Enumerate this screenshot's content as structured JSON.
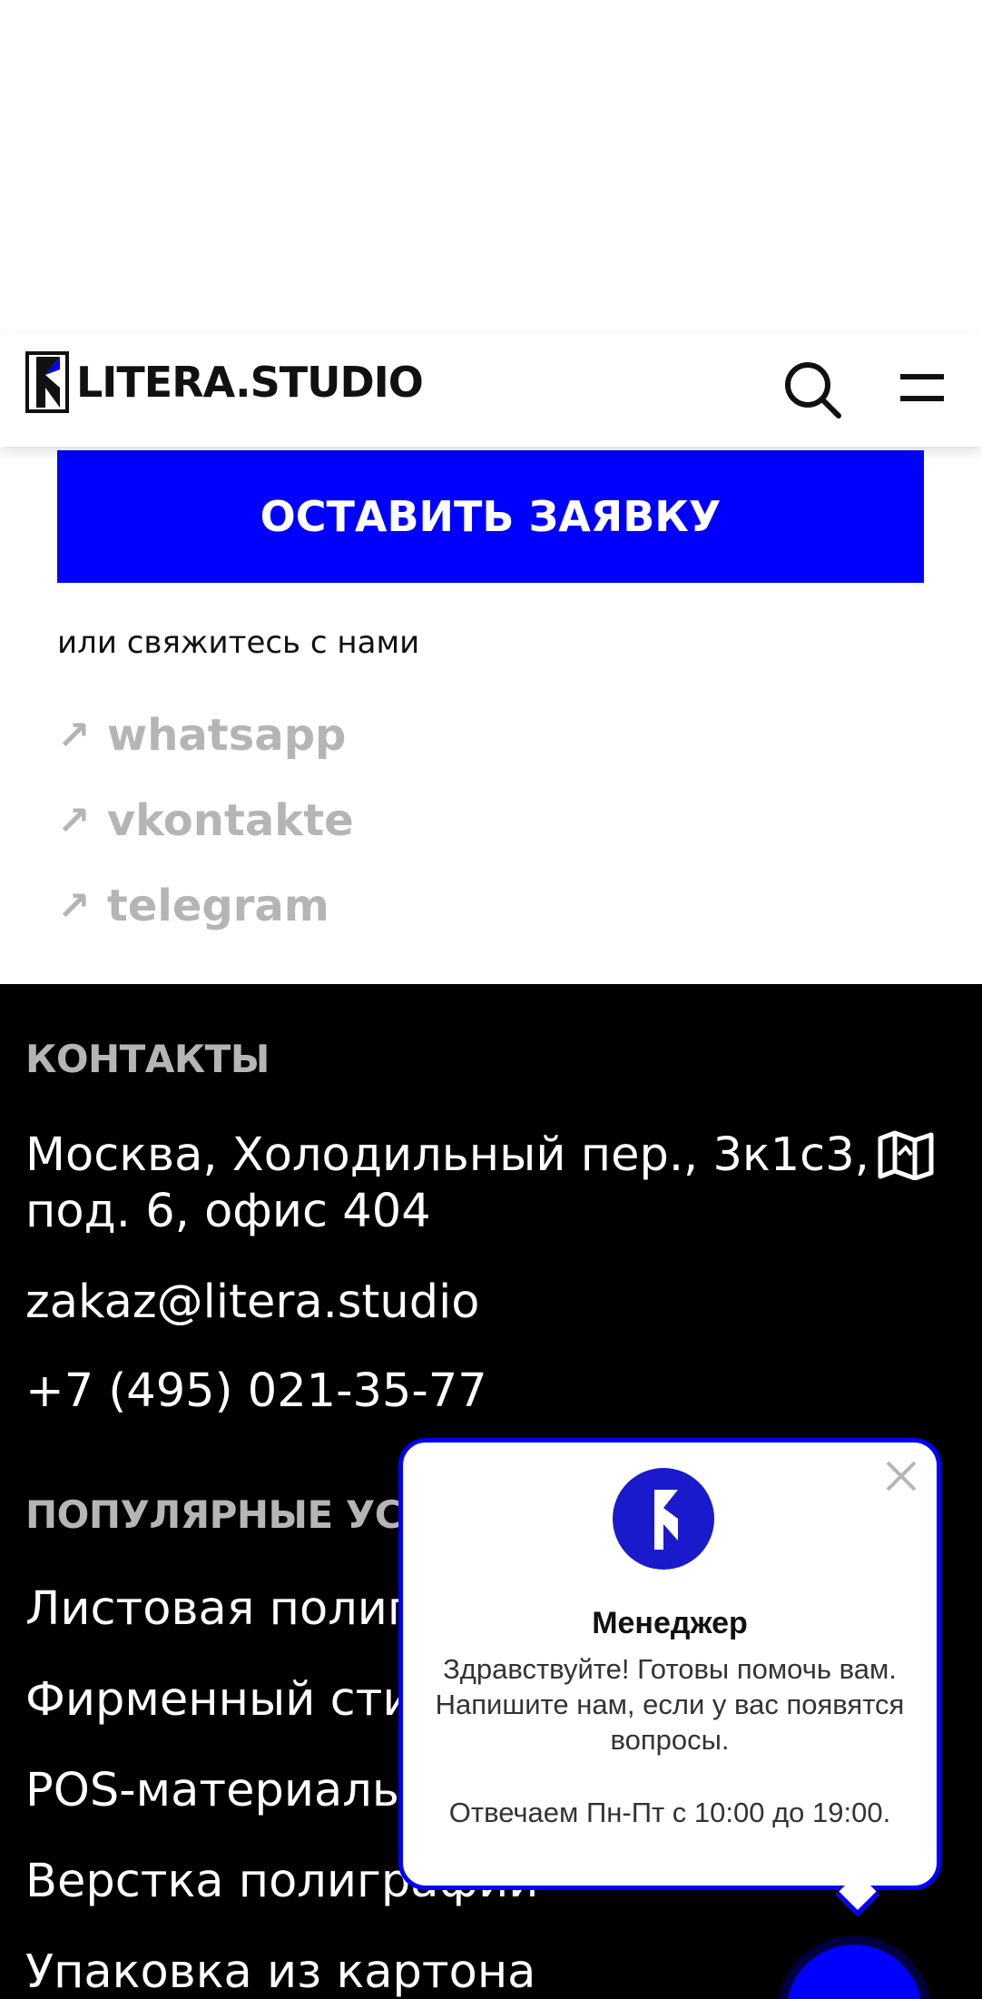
{
  "header": {
    "logo_text": "LITERA.STUDIO",
    "search_icon": "search-icon",
    "menu_icon": "hamburger-icon"
  },
  "cta": {
    "button_label": "ОСТАВИТЬ ЗАЯВКУ",
    "contact_hint": "или свяжитесь с нами"
  },
  "social": [
    {
      "label": "whatsapp",
      "arrow": "↗"
    },
    {
      "label": "vkontakte",
      "arrow": "↗"
    },
    {
      "label": "telegram",
      "arrow": "↗"
    }
  ],
  "footer": {
    "contacts_heading": "КОНТАКТЫ",
    "address_line1": "Москва, Холодильный пер., 3к1с3,",
    "address_line2": "под. 6, офис 404",
    "email": "zakaz@litera.studio",
    "phone": "+7 (495) 021-35-77",
    "services_heading": "ПОПУЛЯРНЫЕ УСЛУГИ",
    "services": [
      "Листовая полиграфия",
      "Фирменный стиль",
      "POS-материалы",
      "Верстка полиграфии",
      "Упаковка из картона"
    ]
  },
  "chat_popup": {
    "name": "Менеджер",
    "message": "Здравствуйте! Готовы помочь вам. Напишите нам, если у вас появятся вопросы.",
    "hours": "Отвечаем Пн-Пт с 10:00 до 19:00."
  },
  "colors": {
    "accent": "#0000ff",
    "footer_bg": "#000000",
    "muted": "#b5b5b5"
  }
}
